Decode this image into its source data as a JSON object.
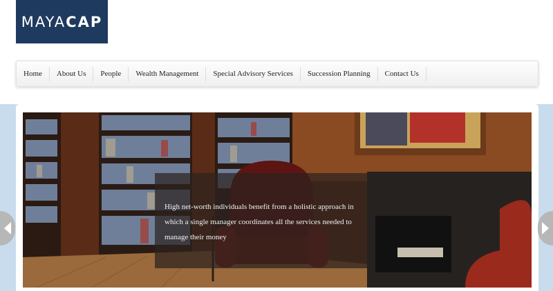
{
  "logo": {
    "text_part1": "MAYA",
    "text_part2": "CAP"
  },
  "nav": {
    "items": [
      "Home",
      "About Us",
      "People",
      "Wealth Management",
      "Special Advisory Services",
      "Succession Planning",
      "Contact Us"
    ]
  },
  "slider": {
    "caption": "High net-worth individuals benefit from a holistic approach in which a single manager coordinates all the services needed to manage their money"
  },
  "colors": {
    "logo_bg": "#1f3a5f",
    "slider_band": "#c9dcee",
    "caption_bg": "#2d231e"
  }
}
